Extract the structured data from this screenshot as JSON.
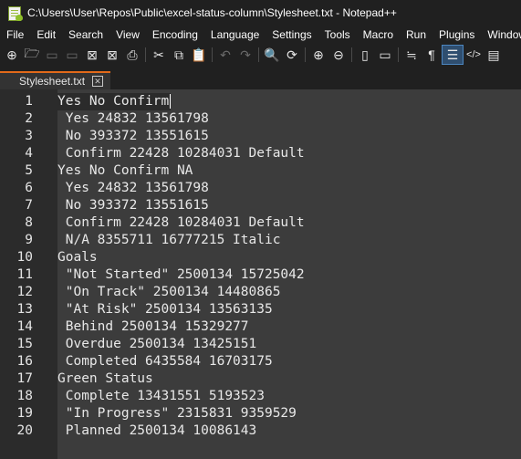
{
  "window": {
    "title": "C:\\Users\\User\\Repos\\Public\\excel-status-column\\Stylesheet.txt - Notepad++"
  },
  "menu": [
    "File",
    "Edit",
    "Search",
    "View",
    "Encoding",
    "Language",
    "Settings",
    "Tools",
    "Macro",
    "Run",
    "Plugins",
    "Window"
  ],
  "toolbar": [
    {
      "icon": "new-file-icon",
      "glyph": "⊕",
      "enabled": true
    },
    {
      "icon": "open-file-icon",
      "glyph": "🗁",
      "enabled": true
    },
    {
      "icon": "save-icon",
      "glyph": "▭",
      "enabled": false
    },
    {
      "icon": "save-all-icon",
      "glyph": "▭",
      "enabled": false
    },
    {
      "icon": "close-icon",
      "glyph": "⊠",
      "enabled": true
    },
    {
      "icon": "close-all-icon",
      "glyph": "⊠",
      "enabled": true
    },
    {
      "icon": "print-icon",
      "glyph": "⎙",
      "enabled": true
    },
    {
      "sep": true
    },
    {
      "icon": "cut-icon",
      "glyph": "✂",
      "enabled": true
    },
    {
      "icon": "copy-icon",
      "glyph": "⧉",
      "enabled": true
    },
    {
      "icon": "paste-icon",
      "glyph": "📋",
      "enabled": false
    },
    {
      "sep": true
    },
    {
      "icon": "undo-icon",
      "glyph": "↶",
      "enabled": false
    },
    {
      "icon": "redo-icon",
      "glyph": "↷",
      "enabled": false
    },
    {
      "sep": true
    },
    {
      "icon": "find-icon",
      "glyph": "🔍",
      "enabled": true
    },
    {
      "icon": "replace-icon",
      "glyph": "⟳",
      "enabled": true
    },
    {
      "sep": true
    },
    {
      "icon": "zoom-in-icon",
      "glyph": "⊕",
      "enabled": true
    },
    {
      "icon": "zoom-out-icon",
      "glyph": "⊖",
      "enabled": true
    },
    {
      "sep": true
    },
    {
      "icon": "sync-vertical-icon",
      "glyph": "▯",
      "enabled": true
    },
    {
      "icon": "sync-horizontal-icon",
      "glyph": "▭",
      "enabled": true
    },
    {
      "sep": true
    },
    {
      "icon": "word-wrap-icon",
      "glyph": "≒",
      "enabled": true
    },
    {
      "icon": "show-all-chars-icon",
      "glyph": "¶",
      "enabled": true
    },
    {
      "icon": "indent-guide-icon",
      "glyph": "☰",
      "enabled": true,
      "active": true
    },
    {
      "icon": "xml-tag-icon",
      "glyph": "</>",
      "enabled": true
    },
    {
      "icon": "document-map-icon",
      "glyph": "▤",
      "enabled": true
    }
  ],
  "tabs": [
    {
      "label": "Stylesheet.txt",
      "active": true
    }
  ],
  "editor": {
    "lines": [
      "Yes No Confirm",
      " Yes 24832 13561798",
      " No 393372 13551615",
      " Confirm 22428 10284031 Default",
      "Yes No Confirm NA",
      " Yes 24832 13561798",
      " No 393372 13551615",
      " Confirm 22428 10284031 Default",
      " N/A 8355711 16777215 Italic",
      "Goals",
      " \"Not Started\" 2500134 15725042",
      " \"On Track\" 2500134 14480865",
      " \"At Risk\" 2500134 13563135",
      " Behind 2500134 15329277",
      " Overdue 2500134 13425151",
      " Completed 6435584 16703175",
      "Green Status",
      " Complete 13431551 5193523",
      " \"In Progress\" 2315831 9359529",
      " Planned 2500134 10086143"
    ]
  }
}
